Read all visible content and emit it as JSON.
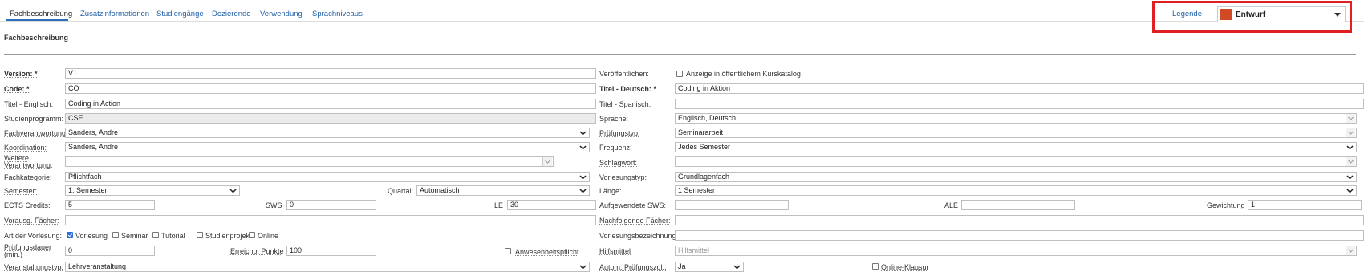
{
  "tabs": [
    "Fachbeschreibung",
    "Zusatzinformationen",
    "Studiengänge",
    "Dozierende",
    "Verwendung",
    "Sprachniveaus"
  ],
  "header": {
    "legend_label": "Legende",
    "status_label": "Entwurf",
    "status_color": "#d04a24",
    "highlight_color": "#e02020"
  },
  "section_title": "Fachbeschreibung",
  "left": {
    "version_label": "Version: *",
    "version_value": "V1",
    "code_label": "Code: *",
    "code_value": "CO",
    "titel_en_label": "Titel - Englisch:",
    "titel_en_value": "Coding in Action",
    "studienprogramm_label": "Studienprogramm:",
    "studienprogramm_value": "CSE",
    "fachverantwortung_label": "Fachverantwortung:",
    "fachverantwortung_value": "Sanders, Andre",
    "koordination_label": "Koordination:",
    "koordination_value": "Sanders, Andre",
    "weitere_label_1": "Weitere",
    "weitere_label_2": "Verantwortung:",
    "weitere_value": "",
    "fachkategorie_label": "Fachkategorie:",
    "fachkategorie_value": "Pflichtfach",
    "semester_label": "Semester:",
    "semester_value": "1. Semester",
    "quartal_label": "Quartal:",
    "quartal_value": "Automatisch",
    "ects_label": "ECTS Credits:",
    "ects_value": "5",
    "sws_label": "SWS",
    "sws_value": "0",
    "le_label": "LE",
    "le_value": "30",
    "vorausg_label": "Vorausg. Fächer:",
    "vorausg_value": "",
    "art_label": "Art der Vorlesung:",
    "art_options": [
      {
        "label": "Vorlesung",
        "checked": true
      },
      {
        "label": "Seminar",
        "checked": false
      },
      {
        "label": "Tutorial",
        "checked": false
      },
      {
        "label": "Studienprojekt",
        "checked": false
      },
      {
        "label": "Online",
        "checked": false
      }
    ],
    "pruefungsdauer_label_1": "Prüfungsdauer",
    "pruefungsdauer_label_2": "(min.)",
    "pruefungsdauer_value": "0",
    "punkte_label": "Erreichb. Punkte",
    "punkte_value": "100",
    "anwesenheit_label": "Anwesenheitspflicht",
    "veranstaltungstyp_label": "Veranstaltungstyp:",
    "veranstaltungstyp_value": "Lehrveranstaltung"
  },
  "right": {
    "veroeffentlichen_label": "Veröffentlichen:",
    "katalog_label": "Anzeige in öffentlichem Kurskatalog",
    "titel_de_label": "Titel - Deutsch: *",
    "titel_de_value": "Coding in Aktion",
    "titel_es_label": "Titel - Spanisch:",
    "titel_es_value": "",
    "sprache_label": "Sprache:",
    "sprache_value": "Englisch, Deutsch",
    "pruefungstyp_label": "Prüfungstyp:",
    "pruefungstyp_value": "Seminararbeit",
    "frequenz_label": "Frequenz:",
    "frequenz_value": "Jedes Semester",
    "schlagwort_label": "Schlagwort:",
    "schlagwort_value": "",
    "vorlesungstyp_label": "Vorlesungstyp:",
    "vorlesungstyp_value": "Grundlagenfach",
    "laenge_label": "Länge:",
    "laenge_value": "1 Semester",
    "aufgewendete_label": "Aufgewendete SWS:",
    "aufgewendete_value": "",
    "ale_label": "ALE",
    "ale_value": "",
    "gewichtung_label": "Gewichtung",
    "gewichtung_value": "1",
    "nachfolgende_label": "Nachfolgende Fächer:",
    "nachfolgende_value": "",
    "bezeichnung_label": "Vorlesungsbezeichnung:",
    "bezeichnung_value": "",
    "hilfsmittel_label": "Hilfsmittel",
    "hilfsmittel_placeholder": "Hilfsmittel",
    "autom_label": "Autom. Prüfungszul.:",
    "autom_value": "Ja",
    "online_klausur_label": "Online-Klausur"
  }
}
